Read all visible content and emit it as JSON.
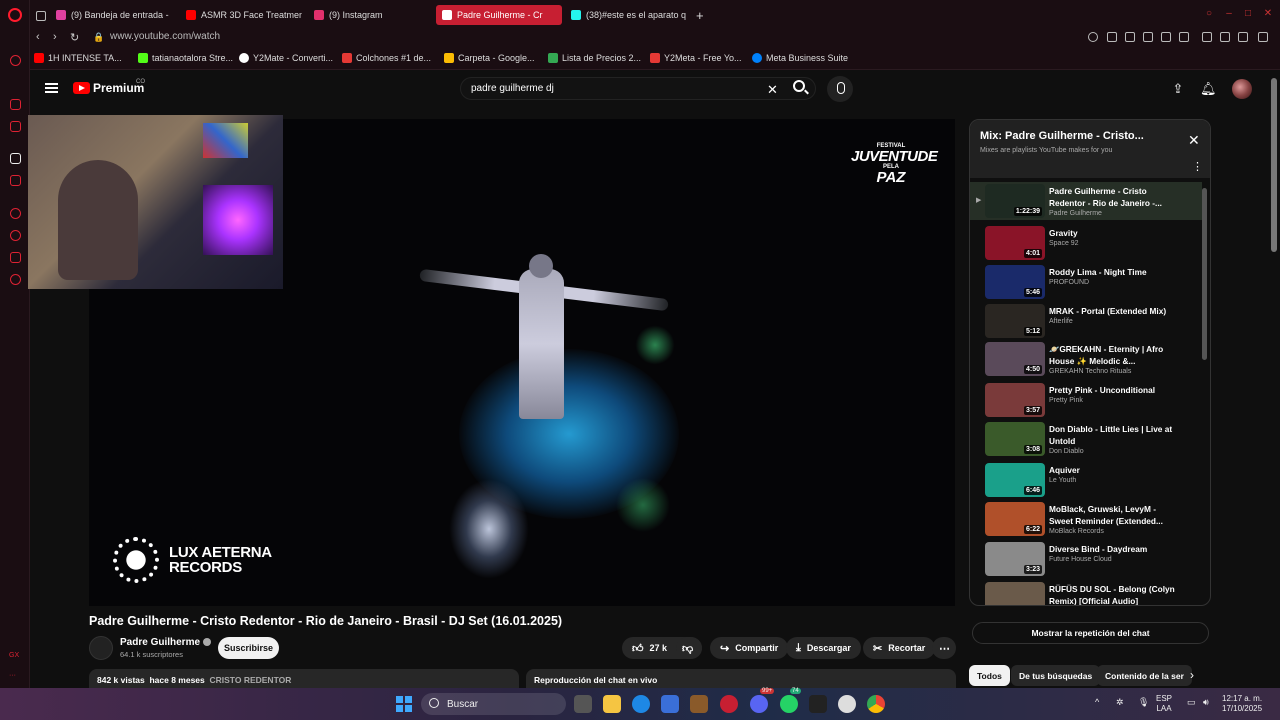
{
  "browser": {
    "tabs": [
      {
        "label": "(9) Bandeja de entrada -",
        "color": "#e040a0"
      },
      {
        "label": "ASMR 3D Face Treatmen",
        "color": "#ff0000"
      },
      {
        "label": "(9) Instagram",
        "color": "#e1306c"
      },
      {
        "label": "Padre Guilherme - Cr",
        "color": "#ffffff",
        "active": true
      },
      {
        "label": "(38)#este es el aparato q",
        "color": "#25f4ee"
      }
    ],
    "url": "www.youtube.com/watch",
    "bookmarks": [
      {
        "label": "1H INTENSE TA...",
        "color": "#ff0000"
      },
      {
        "label": "tatianaotalora Stre...",
        "color": "#53fc18"
      },
      {
        "label": "Y2Mate - Converti...",
        "color": "#ffffff"
      },
      {
        "label": "Colchones #1 de...",
        "color": "#e53935"
      },
      {
        "label": "Carpeta - Google...",
        "color": "#fbbc04"
      },
      {
        "label": "Lista de Precios 2...",
        "color": "#34a853"
      },
      {
        "label": "Y2Meta - Free Yo...",
        "color": "#e53935"
      },
      {
        "label": "Meta Business Suite",
        "color": "#0081fb"
      }
    ],
    "sidebar_label": "GX"
  },
  "youtube": {
    "brand": "Premium",
    "country": "CO",
    "search_value": "padre guilherme dj"
  },
  "video": {
    "festival_small": "FESTIVAL",
    "festival_big": "JUVENTUDE",
    "festival_pela": "PELA",
    "festival_paz": "PAZ",
    "lux_line1": "LUX AETERNA",
    "lux_line2": "RECORDS",
    "title": "Padre Guilherme - Cristo Redentor - Rio de Janeiro - Brasil - DJ Set (16.01.2025)",
    "channel": "Padre Guilherme",
    "subscribers": "64.1 k suscriptores",
    "subscribe_label": "Suscribirse",
    "likes": "27 k",
    "share_label": "Compartir",
    "download_label": "Descargar",
    "clip_label": "Recortar",
    "views": "842 k vistas",
    "ago": "hace 8 meses",
    "tag": "CRISTO REDENTOR",
    "chat_replay": "Reproducción del chat en vivo"
  },
  "mix": {
    "title": "Mix: Padre Guilherme - Cristo...",
    "subtitle": "Mixes are playlists YouTube makes for you",
    "items": [
      {
        "title": "Padre Guilherme - Cristo Redentor - Rio de Janeiro -...",
        "channel": "Padre Guilherme",
        "duration": "1:22:39",
        "color": "#1e2a22",
        "current": true
      },
      {
        "title": "Gravity",
        "channel": "Space 92",
        "duration": "4:01",
        "color": "#8a1428"
      },
      {
        "title": "Roddy Lima - Night Time",
        "channel": "PROFOUND",
        "duration": "5:46",
        "color": "#1a2a6a"
      },
      {
        "title": "MRAK - Portal (Extended Mix)",
        "channel": "Afterlife",
        "duration": "5:12",
        "color": "#2a2622"
      },
      {
        "title": "🪐GREKAHN - Eternity | Afro House ✨ Melodic &...",
        "channel": "GREKAHN Techno Rituals",
        "duration": "4:50",
        "color": "#5a4a5a"
      },
      {
        "title": "Pretty Pink - Unconditional",
        "channel": "Pretty Pink",
        "duration": "3:57",
        "color": "#7a3a3a"
      },
      {
        "title": "Don Diablo - Little Lies | Live at Untold",
        "channel": "Don Diablo",
        "duration": "3:08",
        "color": "#3a5a2a"
      },
      {
        "title": "Aquiver",
        "channel": "Le Youth",
        "duration": "6:46",
        "color": "#1aa08a"
      },
      {
        "title": "MoBlack, Gruwski, LevyM - Sweet Reminder (Extended...",
        "channel": "MoBlack Records",
        "duration": "6:22",
        "color": "#b0502a"
      },
      {
        "title": "Diverse Bind - Daydream",
        "channel": "Future House Cloud",
        "duration": "3:23",
        "color": "#8a8a8a"
      },
      {
        "title": "RÜFÜS DU SOL - Belong (Colyn Remix) [Official Audio]",
        "channel": "",
        "duration": "",
        "color": "#6a5a4a"
      }
    ],
    "show_chat_label": "Mostrar la repetición del chat",
    "chips": [
      "Todos",
      "De tus búsquedas",
      "Contenido de la ser"
    ]
  },
  "taskbar": {
    "search_placeholder": "Buscar",
    "lang": "ESP",
    "lang_sub": "LAA",
    "time": "12:17 a. m.",
    "date": "17/10/2025",
    "badge_discord": "99+",
    "badge_whatsapp": "74"
  }
}
